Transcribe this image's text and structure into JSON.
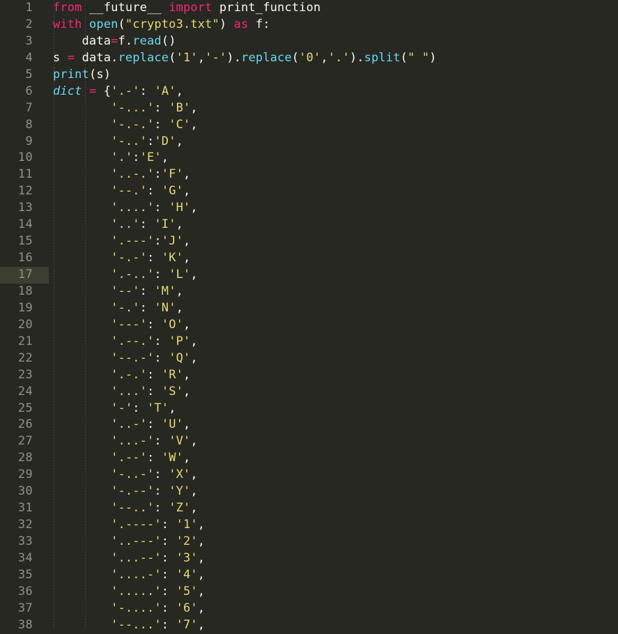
{
  "editor": {
    "language": "python",
    "theme": "monokai",
    "colors": {
      "background": "#272822",
      "foreground": "#f8f8f2",
      "gutter_text": "#90918b",
      "active_line": "#3e3d32",
      "keyword": "#f92672",
      "function": "#66d9ef",
      "string": "#e6db74",
      "indent_guide": "#44453e"
    },
    "active_line_number": 17,
    "indent_guide_x": [
      77,
      122
    ],
    "gutter_width": 70,
    "total_visible_lines": 38
  },
  "lines": [
    {
      "n": "1",
      "indent": "",
      "tokens": [
        {
          "t": "from",
          "c": "kw"
        },
        {
          "t": " ",
          "c": "plain"
        },
        {
          "t": "__future__",
          "c": "plain"
        },
        {
          "t": " ",
          "c": "plain"
        },
        {
          "t": "import",
          "c": "kw"
        },
        {
          "t": " ",
          "c": "plain"
        },
        {
          "t": "print_function",
          "c": "plain"
        }
      ]
    },
    {
      "n": "2",
      "indent": "",
      "tokens": [
        {
          "t": "with",
          "c": "kw"
        },
        {
          "t": " ",
          "c": "plain"
        },
        {
          "t": "open",
          "c": "fn"
        },
        {
          "t": "(",
          "c": "punc"
        },
        {
          "t": "\"crypto3.txt\"",
          "c": "str"
        },
        {
          "t": ")",
          "c": "punc"
        },
        {
          "t": " ",
          "c": "plain"
        },
        {
          "t": "as",
          "c": "kw"
        },
        {
          "t": " ",
          "c": "plain"
        },
        {
          "t": "f",
          "c": "plain"
        },
        {
          "t": ":",
          "c": "punc"
        }
      ]
    },
    {
      "n": "3",
      "indent": "    ",
      "tokens": [
        {
          "t": "data",
          "c": "plain"
        },
        {
          "t": "=",
          "c": "op"
        },
        {
          "t": "f",
          "c": "plain"
        },
        {
          "t": ".",
          "c": "punc"
        },
        {
          "t": "read",
          "c": "fn"
        },
        {
          "t": "()",
          "c": "punc"
        }
      ]
    },
    {
      "n": "4",
      "indent": "",
      "tokens": [
        {
          "t": "s",
          "c": "plain"
        },
        {
          "t": " ",
          "c": "plain"
        },
        {
          "t": "=",
          "c": "op"
        },
        {
          "t": " ",
          "c": "plain"
        },
        {
          "t": "data",
          "c": "plain"
        },
        {
          "t": ".",
          "c": "punc"
        },
        {
          "t": "replace",
          "c": "fn"
        },
        {
          "t": "(",
          "c": "punc"
        },
        {
          "t": "'1'",
          "c": "str"
        },
        {
          "t": ",",
          "c": "punc"
        },
        {
          "t": "'-'",
          "c": "str"
        },
        {
          "t": ")",
          "c": "punc"
        },
        {
          "t": ".",
          "c": "punc"
        },
        {
          "t": "replace",
          "c": "fn"
        },
        {
          "t": "(",
          "c": "punc"
        },
        {
          "t": "'0'",
          "c": "str"
        },
        {
          "t": ",",
          "c": "punc"
        },
        {
          "t": "'.'",
          "c": "str"
        },
        {
          "t": ")",
          "c": "punc"
        },
        {
          "t": ".",
          "c": "punc"
        },
        {
          "t": "split",
          "c": "fn"
        },
        {
          "t": "(",
          "c": "punc"
        },
        {
          "t": "\" \"",
          "c": "str"
        },
        {
          "t": ")",
          "c": "punc"
        }
      ]
    },
    {
      "n": "5",
      "indent": "",
      "tokens": [
        {
          "t": "print",
          "c": "fn"
        },
        {
          "t": "(",
          "c": "punc"
        },
        {
          "t": "s",
          "c": "plain"
        },
        {
          "t": ")",
          "c": "punc"
        }
      ]
    },
    {
      "n": "6",
      "indent": "",
      "tokens": [
        {
          "t": "dict",
          "c": "cls"
        },
        {
          "t": " ",
          "c": "plain"
        },
        {
          "t": "=",
          "c": "op"
        },
        {
          "t": " ",
          "c": "plain"
        },
        {
          "t": "{",
          "c": "punc"
        },
        {
          "t": "'.-'",
          "c": "str"
        },
        {
          "t": ":",
          "c": "punc"
        },
        {
          "t": " ",
          "c": "plain"
        },
        {
          "t": "'A'",
          "c": "str"
        },
        {
          "t": ",",
          "c": "punc"
        }
      ]
    },
    {
      "n": "7",
      "indent": "        ",
      "tokens": [
        {
          "t": "'-...'",
          "c": "str"
        },
        {
          "t": ":",
          "c": "punc"
        },
        {
          "t": " ",
          "c": "plain"
        },
        {
          "t": "'B'",
          "c": "str"
        },
        {
          "t": ",",
          "c": "punc"
        }
      ]
    },
    {
      "n": "8",
      "indent": "        ",
      "tokens": [
        {
          "t": "'-.-.'",
          "c": "str"
        },
        {
          "t": ":",
          "c": "punc"
        },
        {
          "t": " ",
          "c": "plain"
        },
        {
          "t": "'C'",
          "c": "str"
        },
        {
          "t": ",",
          "c": "punc"
        }
      ]
    },
    {
      "n": "9",
      "indent": "        ",
      "tokens": [
        {
          "t": "'-..'",
          "c": "str"
        },
        {
          "t": ":",
          "c": "punc"
        },
        {
          "t": "'D'",
          "c": "str"
        },
        {
          "t": ",",
          "c": "punc"
        }
      ]
    },
    {
      "n": "10",
      "indent": "        ",
      "tokens": [
        {
          "t": "'.'",
          "c": "str"
        },
        {
          "t": ":",
          "c": "punc"
        },
        {
          "t": "'E'",
          "c": "str"
        },
        {
          "t": ",",
          "c": "punc"
        }
      ]
    },
    {
      "n": "11",
      "indent": "        ",
      "tokens": [
        {
          "t": "'..-.'",
          "c": "str"
        },
        {
          "t": ":",
          "c": "punc"
        },
        {
          "t": "'F'",
          "c": "str"
        },
        {
          "t": ",",
          "c": "punc"
        }
      ]
    },
    {
      "n": "12",
      "indent": "        ",
      "tokens": [
        {
          "t": "'--.'",
          "c": "str"
        },
        {
          "t": ":",
          "c": "punc"
        },
        {
          "t": " ",
          "c": "plain"
        },
        {
          "t": "'G'",
          "c": "str"
        },
        {
          "t": ",",
          "c": "punc"
        }
      ]
    },
    {
      "n": "13",
      "indent": "        ",
      "tokens": [
        {
          "t": "'....'",
          "c": "str"
        },
        {
          "t": ":",
          "c": "punc"
        },
        {
          "t": " ",
          "c": "plain"
        },
        {
          "t": "'H'",
          "c": "str"
        },
        {
          "t": ",",
          "c": "punc"
        }
      ]
    },
    {
      "n": "14",
      "indent": "        ",
      "tokens": [
        {
          "t": "'..'",
          "c": "str"
        },
        {
          "t": ":",
          "c": "punc"
        },
        {
          "t": " ",
          "c": "plain"
        },
        {
          "t": "'I'",
          "c": "str"
        },
        {
          "t": ",",
          "c": "punc"
        }
      ]
    },
    {
      "n": "15",
      "indent": "        ",
      "tokens": [
        {
          "t": "'.---'",
          "c": "str"
        },
        {
          "t": ":",
          "c": "punc"
        },
        {
          "t": "'J'",
          "c": "str"
        },
        {
          "t": ",",
          "c": "punc"
        }
      ]
    },
    {
      "n": "16",
      "indent": "        ",
      "tokens": [
        {
          "t": "'-.-'",
          "c": "str"
        },
        {
          "t": ":",
          "c": "punc"
        },
        {
          "t": " ",
          "c": "plain"
        },
        {
          "t": "'K'",
          "c": "str"
        },
        {
          "t": ",",
          "c": "punc"
        }
      ]
    },
    {
      "n": "17",
      "indent": "        ",
      "active": true,
      "tokens": [
        {
          "t": "'.-..'",
          "c": "str"
        },
        {
          "t": ":",
          "c": "punc"
        },
        {
          "t": " ",
          "c": "plain"
        },
        {
          "t": "'L'",
          "c": "str"
        },
        {
          "t": ",",
          "c": "punc"
        }
      ]
    },
    {
      "n": "18",
      "indent": "        ",
      "tokens": [
        {
          "t": "'--'",
          "c": "str"
        },
        {
          "t": ":",
          "c": "punc"
        },
        {
          "t": " ",
          "c": "plain"
        },
        {
          "t": "'M'",
          "c": "str"
        },
        {
          "t": ",",
          "c": "punc"
        }
      ]
    },
    {
      "n": "19",
      "indent": "        ",
      "tokens": [
        {
          "t": "'-.'",
          "c": "str"
        },
        {
          "t": ":",
          "c": "punc"
        },
        {
          "t": " ",
          "c": "plain"
        },
        {
          "t": "'N'",
          "c": "str"
        },
        {
          "t": ",",
          "c": "punc"
        }
      ]
    },
    {
      "n": "20",
      "indent": "        ",
      "tokens": [
        {
          "t": "'---'",
          "c": "str"
        },
        {
          "t": ":",
          "c": "punc"
        },
        {
          "t": " ",
          "c": "plain"
        },
        {
          "t": "'O'",
          "c": "str"
        },
        {
          "t": ",",
          "c": "punc"
        }
      ]
    },
    {
      "n": "21",
      "indent": "        ",
      "tokens": [
        {
          "t": "'.--.'",
          "c": "str"
        },
        {
          "t": ":",
          "c": "punc"
        },
        {
          "t": " ",
          "c": "plain"
        },
        {
          "t": "'P'",
          "c": "str"
        },
        {
          "t": ",",
          "c": "punc"
        }
      ]
    },
    {
      "n": "22",
      "indent": "        ",
      "tokens": [
        {
          "t": "'--.-'",
          "c": "str"
        },
        {
          "t": ":",
          "c": "punc"
        },
        {
          "t": " ",
          "c": "plain"
        },
        {
          "t": "'Q'",
          "c": "str"
        },
        {
          "t": ",",
          "c": "punc"
        }
      ]
    },
    {
      "n": "23",
      "indent": "        ",
      "tokens": [
        {
          "t": "'.-.'",
          "c": "str"
        },
        {
          "t": ":",
          "c": "punc"
        },
        {
          "t": " ",
          "c": "plain"
        },
        {
          "t": "'R'",
          "c": "str"
        },
        {
          "t": ",",
          "c": "punc"
        }
      ]
    },
    {
      "n": "24",
      "indent": "        ",
      "tokens": [
        {
          "t": "'...'",
          "c": "str"
        },
        {
          "t": ":",
          "c": "punc"
        },
        {
          "t": " ",
          "c": "plain"
        },
        {
          "t": "'S'",
          "c": "str"
        },
        {
          "t": ",",
          "c": "punc"
        }
      ]
    },
    {
      "n": "25",
      "indent": "        ",
      "tokens": [
        {
          "t": "'-'",
          "c": "str"
        },
        {
          "t": ":",
          "c": "punc"
        },
        {
          "t": " ",
          "c": "plain"
        },
        {
          "t": "'T'",
          "c": "str"
        },
        {
          "t": ",",
          "c": "punc"
        }
      ]
    },
    {
      "n": "26",
      "indent": "        ",
      "tokens": [
        {
          "t": "'..-'",
          "c": "str"
        },
        {
          "t": ":",
          "c": "punc"
        },
        {
          "t": " ",
          "c": "plain"
        },
        {
          "t": "'U'",
          "c": "str"
        },
        {
          "t": ",",
          "c": "punc"
        }
      ]
    },
    {
      "n": "27",
      "indent": "        ",
      "tokens": [
        {
          "t": "'...-'",
          "c": "str"
        },
        {
          "t": ":",
          "c": "punc"
        },
        {
          "t": " ",
          "c": "plain"
        },
        {
          "t": "'V'",
          "c": "str"
        },
        {
          "t": ",",
          "c": "punc"
        }
      ]
    },
    {
      "n": "28",
      "indent": "        ",
      "tokens": [
        {
          "t": "'.--'",
          "c": "str"
        },
        {
          "t": ":",
          "c": "punc"
        },
        {
          "t": " ",
          "c": "plain"
        },
        {
          "t": "'W'",
          "c": "str"
        },
        {
          "t": ",",
          "c": "punc"
        }
      ]
    },
    {
      "n": "29",
      "indent": "        ",
      "tokens": [
        {
          "t": "'-..-'",
          "c": "str"
        },
        {
          "t": ":",
          "c": "punc"
        },
        {
          "t": " ",
          "c": "plain"
        },
        {
          "t": "'X'",
          "c": "str"
        },
        {
          "t": ",",
          "c": "punc"
        }
      ]
    },
    {
      "n": "30",
      "indent": "        ",
      "tokens": [
        {
          "t": "'-.--'",
          "c": "str"
        },
        {
          "t": ":",
          "c": "punc"
        },
        {
          "t": " ",
          "c": "plain"
        },
        {
          "t": "'Y'",
          "c": "str"
        },
        {
          "t": ",",
          "c": "punc"
        }
      ]
    },
    {
      "n": "31",
      "indent": "        ",
      "tokens": [
        {
          "t": "'--..'",
          "c": "str"
        },
        {
          "t": ":",
          "c": "punc"
        },
        {
          "t": " ",
          "c": "plain"
        },
        {
          "t": "'Z'",
          "c": "str"
        },
        {
          "t": ",",
          "c": "punc"
        }
      ]
    },
    {
      "n": "32",
      "indent": "        ",
      "tokens": [
        {
          "t": "'.----'",
          "c": "str"
        },
        {
          "t": ":",
          "c": "punc"
        },
        {
          "t": " ",
          "c": "plain"
        },
        {
          "t": "'1'",
          "c": "str"
        },
        {
          "t": ",",
          "c": "punc"
        }
      ]
    },
    {
      "n": "33",
      "indent": "        ",
      "tokens": [
        {
          "t": "'..---'",
          "c": "str"
        },
        {
          "t": ":",
          "c": "punc"
        },
        {
          "t": " ",
          "c": "plain"
        },
        {
          "t": "'2'",
          "c": "str"
        },
        {
          "t": ",",
          "c": "punc"
        }
      ]
    },
    {
      "n": "34",
      "indent": "        ",
      "tokens": [
        {
          "t": "'...--'",
          "c": "str"
        },
        {
          "t": ":",
          "c": "punc"
        },
        {
          "t": " ",
          "c": "plain"
        },
        {
          "t": "'3'",
          "c": "str"
        },
        {
          "t": ",",
          "c": "punc"
        }
      ]
    },
    {
      "n": "35",
      "indent": "        ",
      "tokens": [
        {
          "t": "'....-'",
          "c": "str"
        },
        {
          "t": ":",
          "c": "punc"
        },
        {
          "t": " ",
          "c": "plain"
        },
        {
          "t": "'4'",
          "c": "str"
        },
        {
          "t": ",",
          "c": "punc"
        }
      ]
    },
    {
      "n": "36",
      "indent": "        ",
      "tokens": [
        {
          "t": "'.....'",
          "c": "str"
        },
        {
          "t": ":",
          "c": "punc"
        },
        {
          "t": " ",
          "c": "plain"
        },
        {
          "t": "'5'",
          "c": "str"
        },
        {
          "t": ",",
          "c": "punc"
        }
      ]
    },
    {
      "n": "37",
      "indent": "        ",
      "tokens": [
        {
          "t": "'-....'",
          "c": "str"
        },
        {
          "t": ":",
          "c": "punc"
        },
        {
          "t": " ",
          "c": "plain"
        },
        {
          "t": "'6'",
          "c": "str"
        },
        {
          "t": ",",
          "c": "punc"
        }
      ]
    },
    {
      "n": "38",
      "indent": "        ",
      "tokens": [
        {
          "t": "'--...'",
          "c": "str"
        },
        {
          "t": ":",
          "c": "punc"
        },
        {
          "t": " ",
          "c": "plain"
        },
        {
          "t": "'7'",
          "c": "str"
        },
        {
          "t": ",",
          "c": "punc"
        }
      ]
    }
  ]
}
